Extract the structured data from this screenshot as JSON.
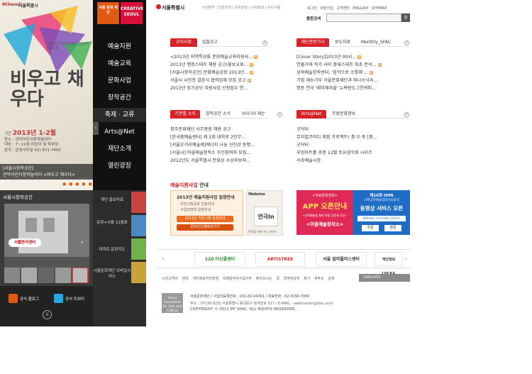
{
  "left_promo": {
    "top_logos": [
      "HiSeoul",
      "서울특별시"
    ],
    "hero_title": "비우고 채우다",
    "hero_subtitle": "관악어린이창작놀이터 가을방학프로그램",
    "info_period_label": "기간",
    "info_date": "2013년 1-2월",
    "info_place": "장소 : 관악어린이창작놀이터",
    "info_target": "대상 : 7~12세 어린이 및 학부모",
    "info_contact": "문의 : 운영사무실 02) 871-7400",
    "caption_line1": "[서울시창작공간]",
    "caption_line2": "관악어린이창작놀이터 <비우고 채우다>",
    "dots": "● ● ● ● ●",
    "space_title": "서울시창작공간",
    "space_logo": "서울연극센터",
    "blog_btn": "공식 블로그",
    "twitter_btn": "공식 트위터",
    "pause": "II"
  },
  "nav": {
    "logo1": "서울 문화 재단",
    "logo2": "CREATIVE SEOUL",
    "items": [
      "예술지원",
      "예술교육",
      "문화사업",
      "창작공간",
      "축제 · 교류",
      "Arts@Net",
      "재단소개",
      "열린광장"
    ],
    "collapse": "‹",
    "sub_items": [
      "재단 홍보자료",
      "문화+서울 12월호",
      "대학로 문화지도",
      "서울문화재단 모바일서비스"
    ]
  },
  "header": {
    "logo": "서울특별시",
    "links": "시민참여 | 민원안내 | 문화관광 | 시정정보 | 수도서울",
    "util": "로그인 회원가입 고객센터 ENGLISH SITEMAP",
    "search_label": "통합검색",
    "search_value": "",
    "search_icon": "search-icon"
  },
  "boards": {
    "notice": {
      "tabs": [
        "공지사항",
        "입찰공고"
      ],
      "posts": [
        "<2013년 지역특성화 문화예술교육지원사...",
        "2013년 행정스태프 채용 공고(홍보교류...",
        "[서울시창작공간] 문화예술공장 2013년...",
        "서울시 시민청 결혼식 협력업체 모집 공고",
        "2013년 정기공모 지원사업 신청접수 연..."
      ]
    },
    "pr": {
      "tabs": [
        "재단관련기사",
        "보도자료",
        "Monthly_SFAC"
      ],
      "posts": [
        "[Cover Story]2013년 00시...",
        "연출가와 작가 사이 중재스태프 최초 분석...",
        "성북예술창작센터, '음악으로 소통해'...",
        "기업 재능기부 서울문화재단과 파나소닉과...",
        "명동 연극 '레미제라블' 뉴욕랑도그연커피..."
      ]
    },
    "org": {
      "tabs": [
        "기관별 소식",
        "창작공간 소식",
        "아이디어 제안"
      ],
      "posts": [
        "청주문화재단 사무총장 채용 공고",
        "[한국춤예술센터] 제 2회 대학로 2인무...",
        "[서울오거리예술제]에너지 나눔 선진강 동행...",
        "[서울시] 마을예술창작소 주민참여자 모집...",
        "2012년도 서울특별시 문화상 수상후보자..."
      ]
    },
    "arts": {
      "tabs": [
        "Arts@Net",
        "무료문화정보"
      ],
      "posts": [
        "굿닥터",
        "뮤지컬코미디 체험 프로젝트! 충·우·동 [충...",
        "굿닥터",
        "부암아트홀 초청 12월 토요음악회 시리즈",
        "서초예술시장"
      ]
    },
    "new_badge": "N",
    "more_icon": "+"
  },
  "projects": {
    "title_red": "예술지원사업",
    "title_rest": " 안내",
    "banner_title": "2013년 예술지원사업 일정안내",
    "banner_lines": [
      "· 지원신청공모 일정안내",
      "· 사업설명회 일정안내"
    ],
    "btn1": "2013년 지원신청 일정안내",
    "btn2": "온라인신청바로가기",
    "mag_label": "Webzine",
    "mag_title": "연극In",
    "mag_caption": "관객을 위한 연극 가이드",
    "ad1_top": "<무료문화정보>",
    "ad1_title": "APP 오픈안내",
    "ad1_sub": "~문화예술을 통한 마을 공동체 사업~",
    "ad1_bottom": "<마을예술창작소>",
    "ad2_top": "제26회 ISPA",
    "ad2_sub": "국제공연예술협회서울총회",
    "ad2_title": "동영상 서비스 오픈",
    "ad2_note": "ISPA 메인 사이트에서 다운로드",
    "ad2_b1": "국문",
    "ad2_b2": "영문"
  },
  "partners": {
    "prev": "‹",
    "next": "›",
    "items": [
      "120 다산콜센터",
      "ARTISTREE",
      "서울 알피플러스센터",
      "개인정보 LOCK&"
    ]
  },
  "footer": {
    "links": "시민고객의 권리 개인정보처리방침 이메일무단수집거부 찾아오시는 길 업무담당자 찾기 새주소 검색",
    "family": "FAMILYSITE",
    "logo": "Seoul Foundation for Arts and Culture",
    "org": "서울문화재단 / 사업자등록번호 : 201-82-04361 / 대표전화 : 02-3290-7000",
    "addr": "주소 : (우130-823) 서울특별시 동대문구 청계천로 517 / E-MAIL : webmaster@sfac.or.kr",
    "copy": "COPYRIGHT © 2011 BY SFAC. ALL RIGHTS RESERVED."
  }
}
